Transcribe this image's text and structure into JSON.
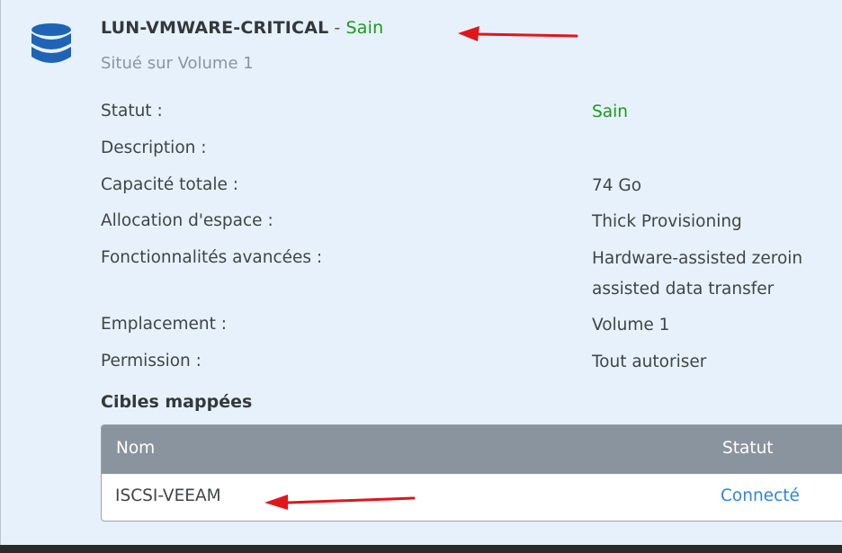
{
  "header": {
    "title": "LUN-VMWARE-CRITICAL",
    "separator": "-",
    "status": "Sain",
    "subtitle": "Situé sur Volume 1"
  },
  "icon": "database-icon",
  "properties": [
    {
      "label": "Statut :",
      "value": "Sain"
    },
    {
      "label": "Description :",
      "value": ""
    },
    {
      "label": "Capacité totale :",
      "value": "74 Go"
    },
    {
      "label": "Allocation d'espace :",
      "value": "Thick Provisioning"
    },
    {
      "label": "Fonctionnalités avancées :",
      "value": "Hardware-assisted zeroin",
      "value_line2": "assisted data transfer"
    },
    {
      "label": "Emplacement :",
      "value": "Volume 1"
    },
    {
      "label": "Permission :",
      "value": "Tout autoriser"
    }
  ],
  "mapped_targets": {
    "title": "Cibles mappées",
    "columns": [
      "Nom",
      "Statut"
    ],
    "rows": [
      {
        "name": "ISCSI-VEEAM",
        "status": "Connecté"
      }
    ]
  },
  "colors": {
    "healthy": "#1a9a1a",
    "link": "#2f86d6",
    "annotation_arrow": "#e0161b"
  }
}
